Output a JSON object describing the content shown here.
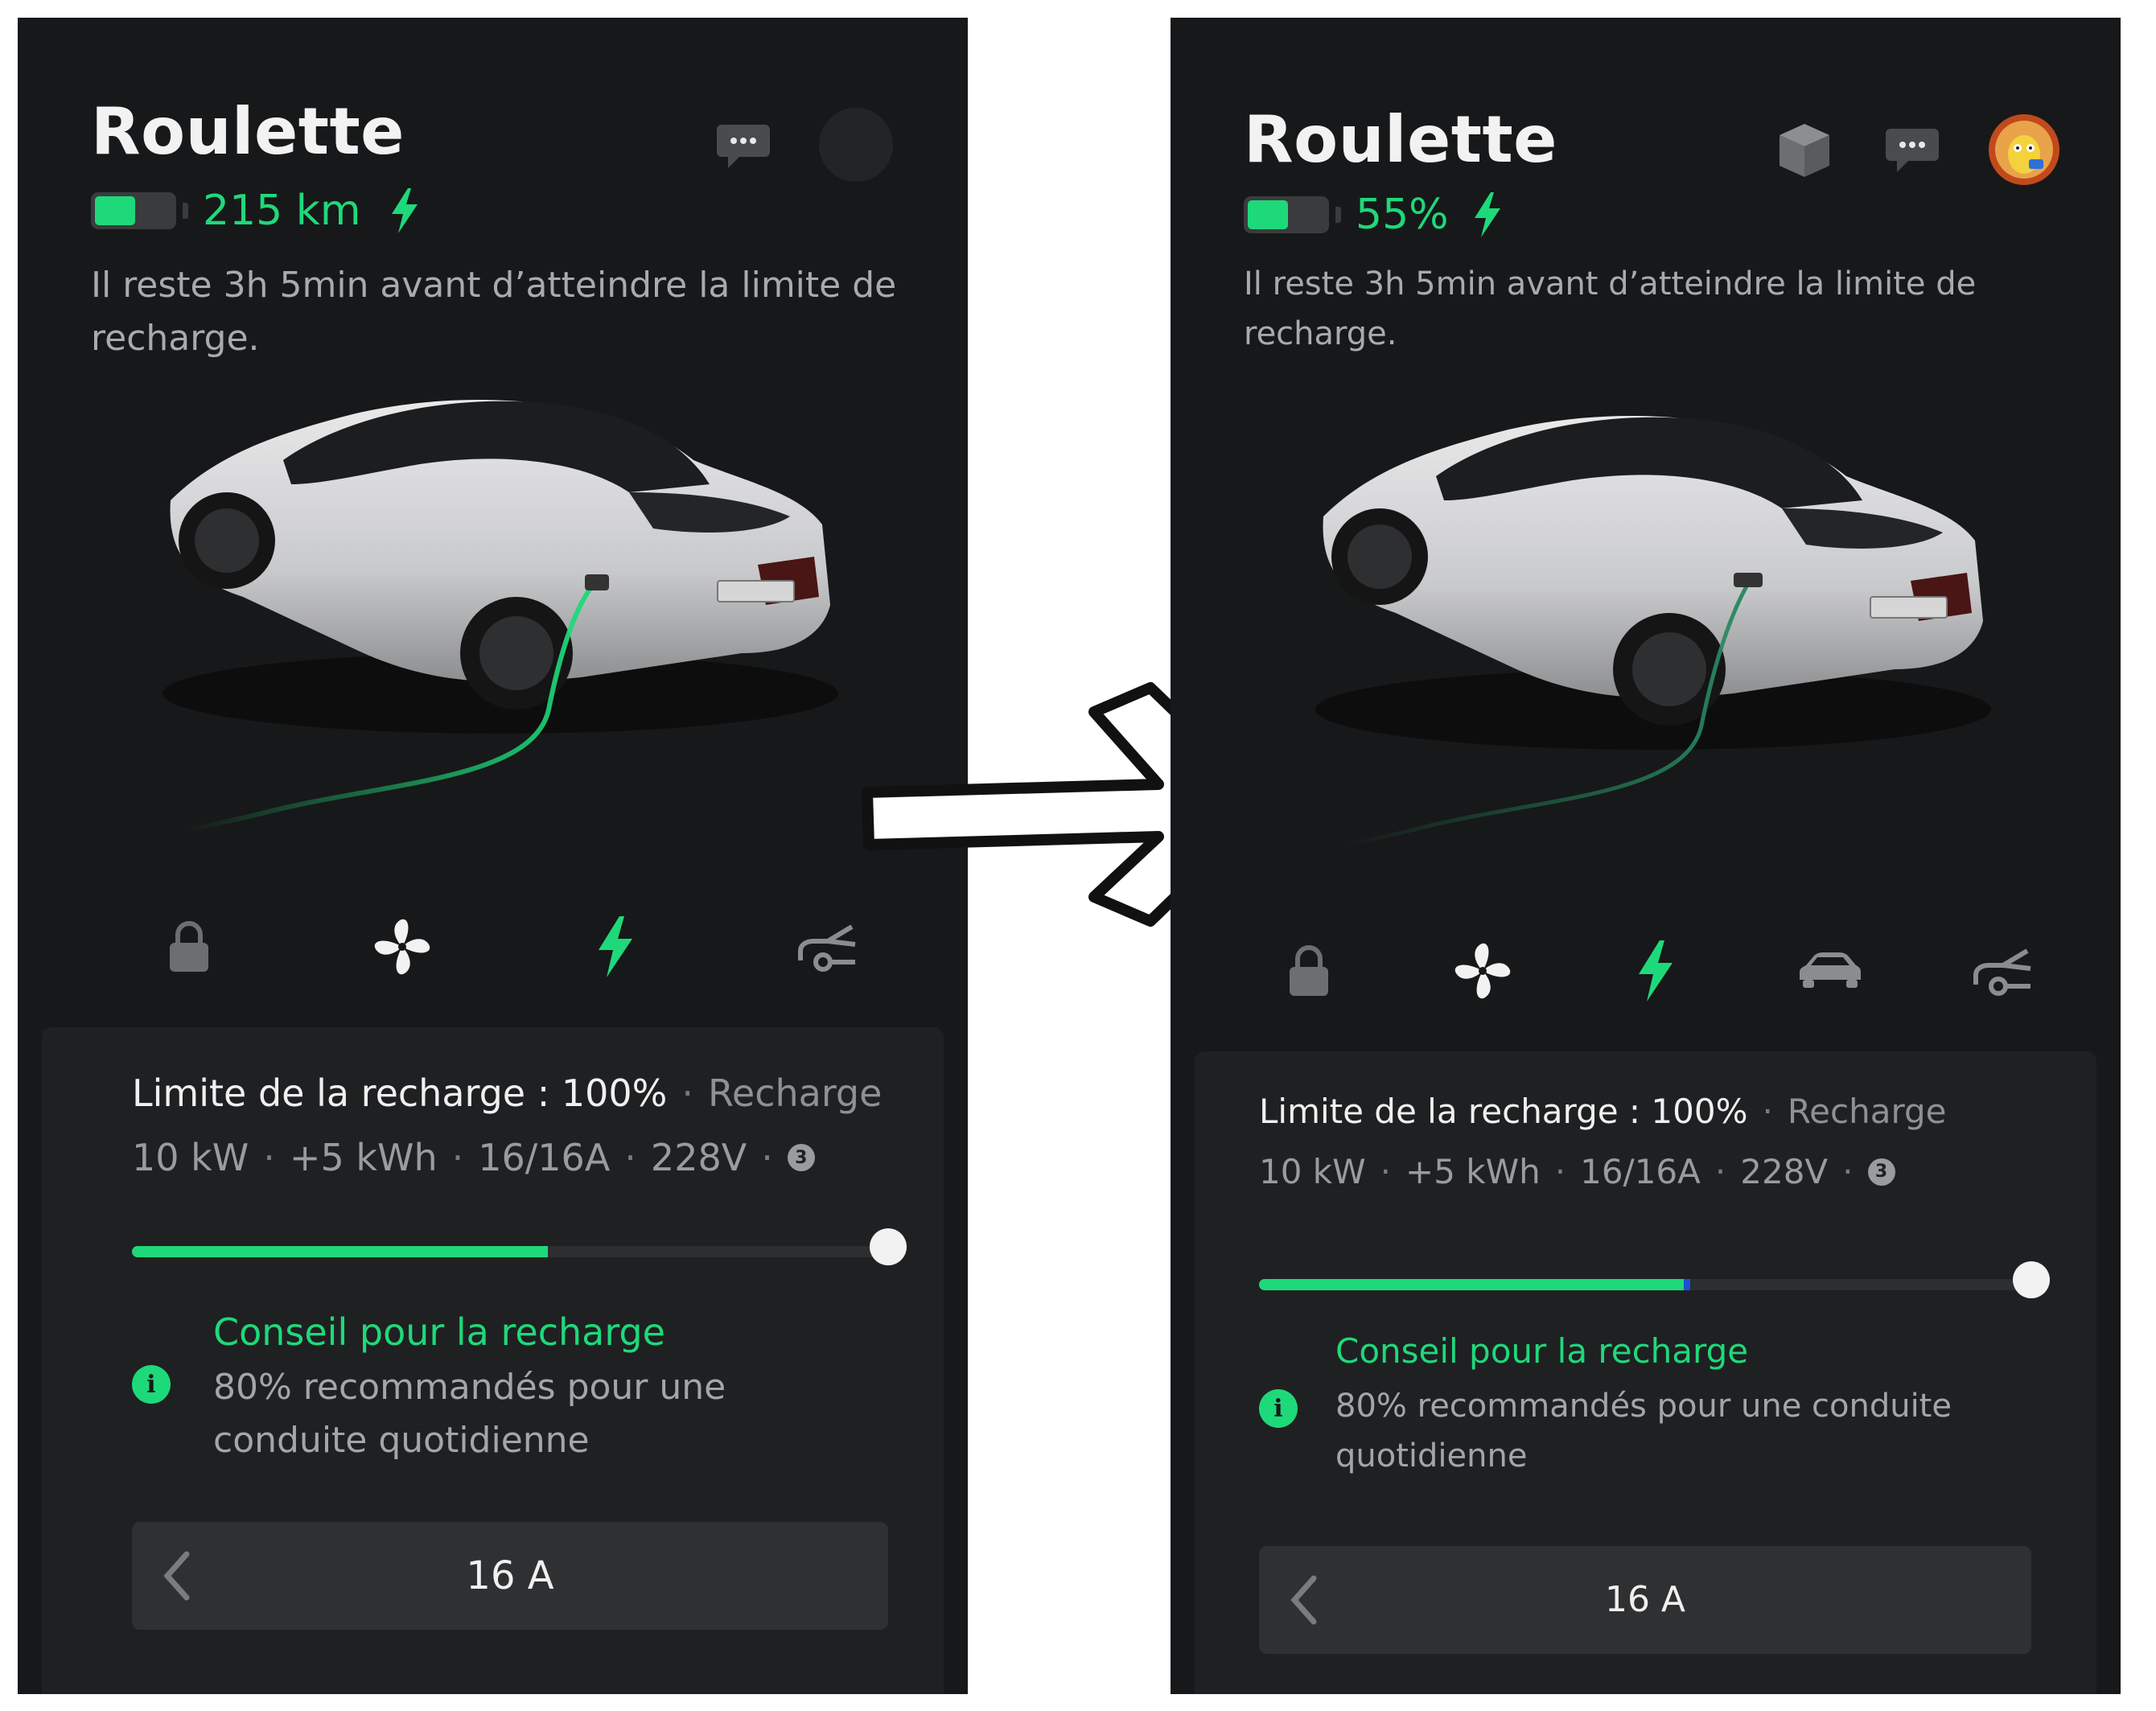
{
  "left": {
    "car_name": "Roulette",
    "range": "215 km",
    "charge_info": "Il reste 3h 5min avant d’atteindre la limite de recharge.",
    "charge_limit_label": "Limite de la recharge : 100%",
    "charge_status": "Recharge",
    "stats": {
      "power": "10 kW",
      "energy": "+5 kWh",
      "current": "16/16A",
      "voltage": "228V",
      "phases": "3"
    },
    "charge_progress": 0.55,
    "tip_title": "Conseil pour la recharge",
    "tip_body": "80% recommandés pour une conduite quotidienne",
    "amperage": "16 A",
    "icons": {
      "header": [
        "chat-icon",
        "avatar-placeholder"
      ],
      "controls": [
        "lock-icon",
        "fan-icon",
        "charge-bolt-icon",
        "trunk-icon"
      ]
    }
  },
  "right": {
    "car_name": "Roulette",
    "range": "55%",
    "charge_info": "Il reste 3h 5min avant d’atteindre la limite de recharge.",
    "charge_limit_label": "Limite de la recharge : 100%",
    "charge_status": "Recharge",
    "stats": {
      "power": "10 kW",
      "energy": "+5 kWh",
      "current": "16/16A",
      "voltage": "228V",
      "phases": "3"
    },
    "charge_progress": 0.55,
    "tip_title": "Conseil pour la recharge",
    "tip_body": "80% recommandés pour une conduite quotidienne",
    "amperage": "16 A",
    "icons": {
      "header": [
        "cube-icon",
        "chat-icon",
        "avatar"
      ],
      "controls": [
        "lock-icon",
        "fan-icon",
        "charge-bolt-icon",
        "car-icon",
        "trunk-icon"
      ]
    }
  },
  "colors": {
    "accent": "#1ed97a",
    "panel_bg": "#171819",
    "card_bg": "#1f2022",
    "text": "#f2f2f2",
    "muted": "#a9aaab"
  }
}
